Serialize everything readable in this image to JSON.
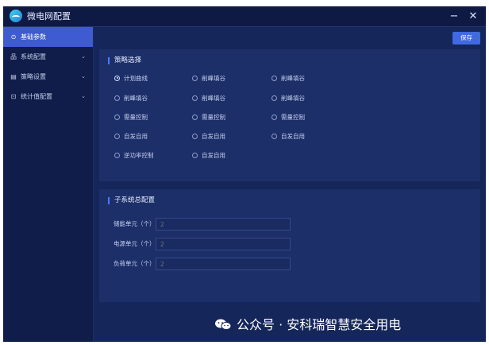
{
  "window": {
    "title": "微电网配置",
    "minimize": "−",
    "close": "✕"
  },
  "toolbar": {
    "save_label": "保存"
  },
  "sidebar": {
    "items": [
      {
        "label": "基础参数",
        "active": true
      },
      {
        "label": "系统配置",
        "chevron": "⌄"
      },
      {
        "label": "策略设置",
        "chevron": "⌄"
      },
      {
        "label": "统计值配置",
        "chevron": "⌄"
      }
    ]
  },
  "strategy": {
    "title": "策略选择",
    "options": [
      "计划曲线",
      "削峰填谷",
      "削峰填谷",
      "削峰填谷",
      "削峰填谷",
      "削峰填谷",
      "需量控制",
      "需量控制",
      "需量控制",
      "自发自用",
      "自发自用",
      "自发自用",
      "逆功率控制",
      "自发自用"
    ],
    "selected_index": 0
  },
  "subsystem": {
    "title": "子系统总配置",
    "fields": [
      {
        "label": "储能单元（个）",
        "placeholder": "2"
      },
      {
        "label": "电源单元（个）",
        "placeholder": "2"
      },
      {
        "label": "负荷单元（个）",
        "placeholder": "2"
      }
    ]
  },
  "watermark": {
    "text": "公众号 · 安科瑞智慧安全用电"
  }
}
